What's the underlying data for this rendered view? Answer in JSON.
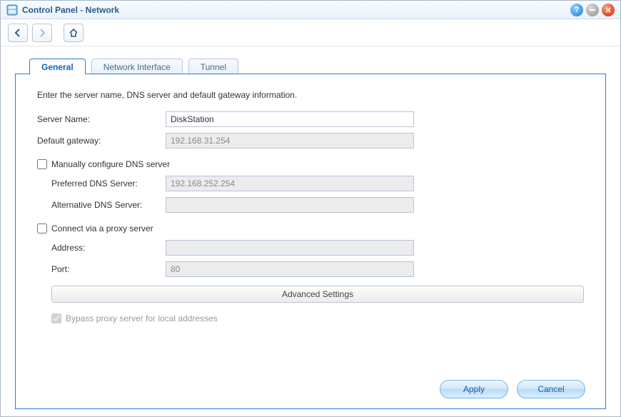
{
  "window": {
    "title": "Control Panel - Network"
  },
  "tabs": [
    {
      "label": "General"
    },
    {
      "label": "Network Interface"
    },
    {
      "label": "Tunnel"
    }
  ],
  "panel": {
    "description": "Enter the server name, DNS server and default gateway information.",
    "server_name_label": "Server Name:",
    "server_name_value": "DiskStation",
    "default_gateway_label": "Default gateway:",
    "default_gateway_value": "192.168.31.254",
    "manual_dns_label": "Manually configure DNS server",
    "preferred_dns_label": "Preferred DNS Server:",
    "preferred_dns_value": "192.168.252.254",
    "alternative_dns_label": "Alternative DNS Server:",
    "alternative_dns_value": "",
    "proxy_label": "Connect via a proxy server",
    "proxy_address_label": "Address:",
    "proxy_address_value": "",
    "proxy_port_label": "Port:",
    "proxy_port_value": "80",
    "advanced_button": "Advanced Settings",
    "bypass_label": "Bypass proxy server for local addresses"
  },
  "footer": {
    "apply": "Apply",
    "cancel": "Cancel"
  }
}
